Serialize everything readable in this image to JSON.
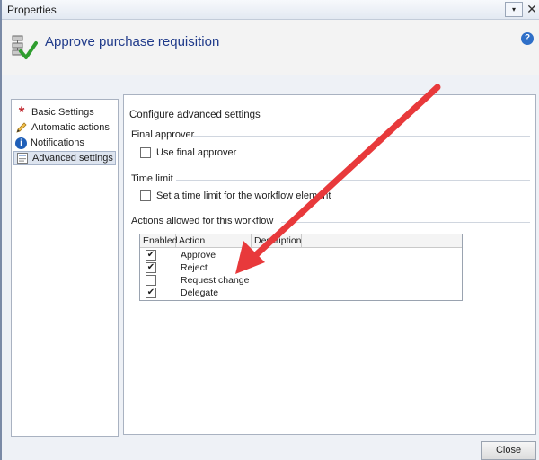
{
  "window": {
    "title": "Properties"
  },
  "titlebar": {
    "dropdown_glyph": "▾",
    "close_glyph": "✕"
  },
  "header": {
    "title": "Approve purchase requisition",
    "help_glyph": "?"
  },
  "sidebar": {
    "items": [
      {
        "label": "Basic Settings",
        "icon": "asterisk-icon",
        "selected": false
      },
      {
        "label": "Automatic actions",
        "icon": "pencil-icon",
        "selected": false
      },
      {
        "label": "Notifications",
        "icon": "info-icon",
        "selected": false
      },
      {
        "label": "Advanced settings",
        "icon": "settings-icon",
        "selected": true
      }
    ]
  },
  "panel": {
    "title": "Configure advanced settings",
    "final_approver": {
      "label": "Final approver",
      "checkbox_label": "Use final approver",
      "checked": false
    },
    "time_limit": {
      "label": "Time limit",
      "checkbox_label": "Set a time limit for the workflow element",
      "checked": false
    },
    "actions": {
      "label": "Actions allowed for this workflow",
      "columns": [
        "Enabled",
        "Action",
        "Description"
      ],
      "rows": [
        {
          "enabled": true,
          "action": "Approve"
        },
        {
          "enabled": true,
          "action": "Reject"
        },
        {
          "enabled": false,
          "action": "Request change"
        },
        {
          "enabled": true,
          "action": "Delegate"
        }
      ]
    }
  },
  "footer": {
    "close_label": "Close"
  },
  "colors": {
    "header_title": "#1f3a8a",
    "annotation_arrow": "#e8393b",
    "help_icon": "#2f6fc8"
  }
}
